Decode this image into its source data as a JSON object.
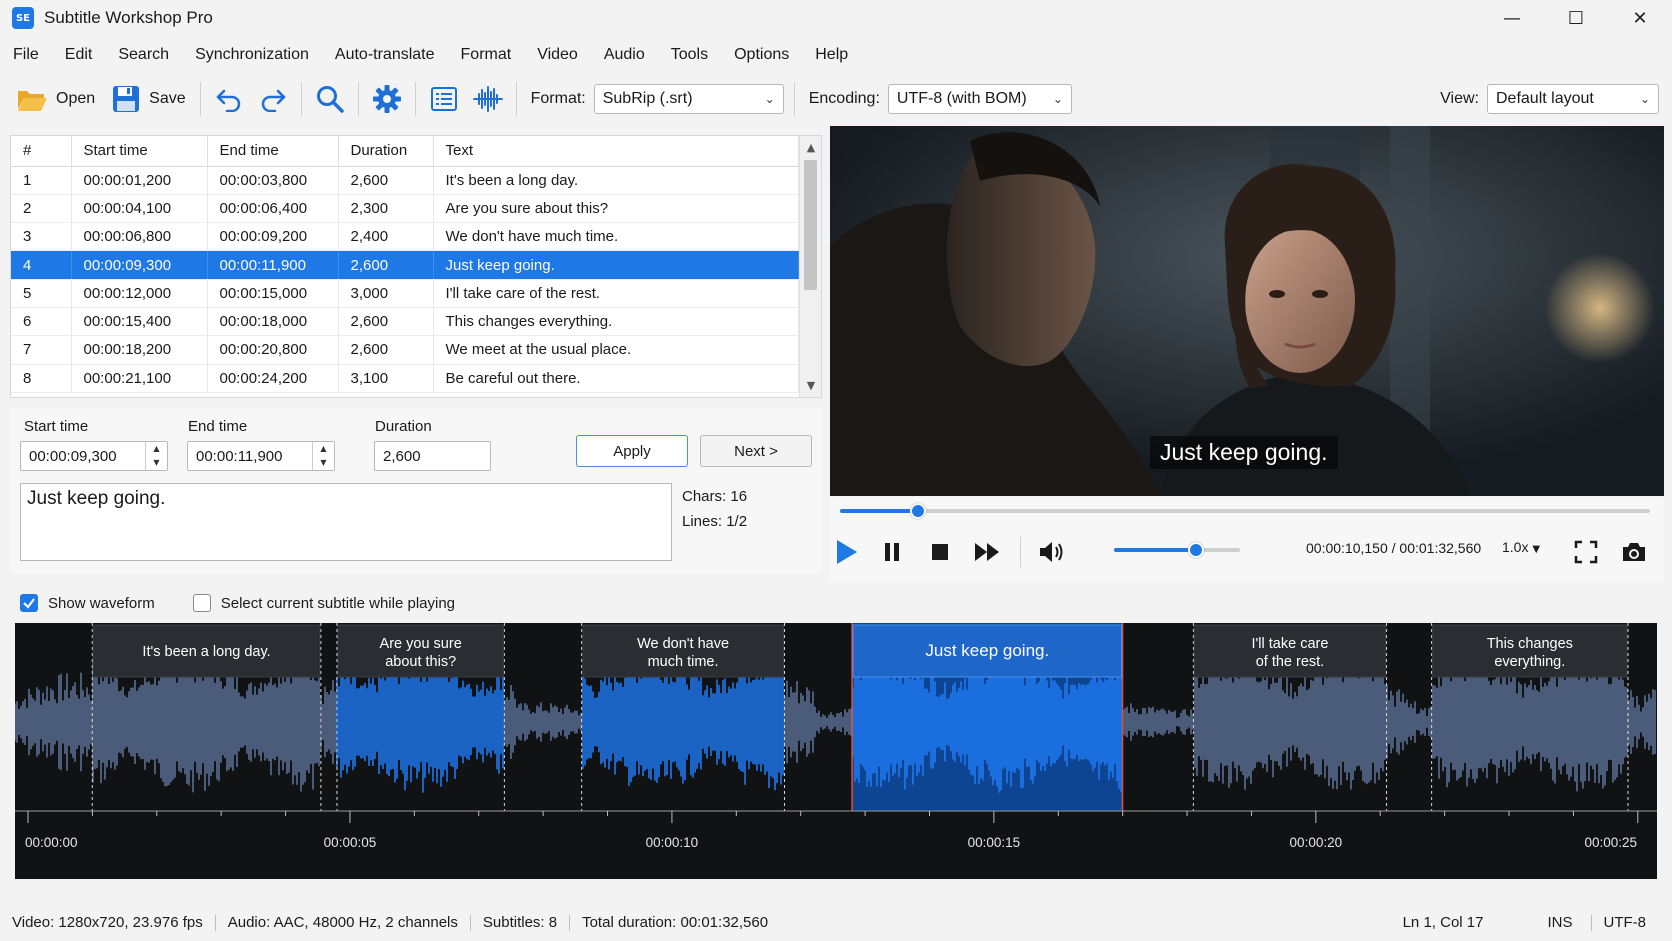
{
  "window": {
    "logo": "SE",
    "title": "Subtitle Workshop Pro",
    "minimize": "—",
    "maximize": "☐",
    "close": "✕"
  },
  "menu": [
    "File",
    "Edit",
    "Search",
    "Synchronization",
    "Auto-translate",
    "Format",
    "Video",
    "Audio",
    "Tools",
    "Options",
    "Help"
  ],
  "toolbar": {
    "open_label": "Open",
    "save_label": "Save",
    "format_label": "Format:",
    "format_value": "SubRip (.srt)",
    "encoding_label": "Encoding:",
    "encoding_value": "UTF-8 (with BOM)",
    "view_label": "View:",
    "view_value": "Default layout"
  },
  "grid": {
    "columns": [
      "#",
      "Start time",
      "End time",
      "Duration",
      "Text"
    ],
    "selected_index": 3,
    "rows": [
      [
        "1",
        "00:00:01,200",
        "00:00:03,800",
        "2,600",
        "It's been a long day."
      ],
      [
        "2",
        "00:00:04,100",
        "00:00:06,400",
        "2,300",
        "Are you sure about this?"
      ],
      [
        "3",
        "00:00:06,800",
        "00:00:09,200",
        "2,400",
        "We don't have much time."
      ],
      [
        "4",
        "00:00:09,300",
        "00:00:11,900",
        "2,600",
        "Just keep going."
      ],
      [
        "5",
        "00:00:12,000",
        "00:00:15,000",
        "3,000",
        "I'll take care of the rest."
      ],
      [
        "6",
        "00:00:15,400",
        "00:00:18,000",
        "2,600",
        "This changes everything."
      ],
      [
        "7",
        "00:00:18,200",
        "00:00:20,800",
        "2,600",
        "We meet at the usual place."
      ],
      [
        "8",
        "00:00:21,100",
        "00:00:24,200",
        "3,100",
        "Be careful out there."
      ]
    ]
  },
  "editor": {
    "start_label": "Start time",
    "start_value": "00:00:09,300",
    "end_label": "End time",
    "end_value": "00:00:11,900",
    "duration_label": "Duration",
    "duration_value": "2,600",
    "apply_label": "Apply",
    "next_label": "Next >",
    "text_value": "Just keep going.",
    "chars": "Chars: 16",
    "lines": "Lines: 1/2"
  },
  "video": {
    "subtitle": "Just keep going."
  },
  "player": {
    "progress_fraction": 0.0958,
    "volume_fraction": 0.65,
    "time_readout": "00:00:10,150 / 00:01:32,560",
    "speed": "1.0x"
  },
  "waveform_options": {
    "show_waveform_label": "Show waveform",
    "show_waveform_checked": true,
    "select_current_label": "Select current subtitle while playing",
    "select_current_checked": false
  },
  "waveform": {
    "visible_range_seconds": [
      0,
      25.5
    ],
    "selected_index": 3,
    "segments": [
      {
        "start": 1.2,
        "end": 4.75,
        "lines": [
          "It's been a long day."
        ]
      },
      {
        "start": 5.0,
        "end": 7.6,
        "lines": [
          "Are you sure",
          "about this?"
        ]
      },
      {
        "start": 8.8,
        "end": 11.95,
        "lines": [
          "We don't have",
          "much time."
        ]
      },
      {
        "start": 13.0,
        "end": 17.2,
        "lines": [
          "Just keep going."
        ]
      },
      {
        "start": 18.3,
        "end": 21.3,
        "lines": [
          "I'll take care",
          "of the rest."
        ]
      },
      {
        "start": 22.0,
        "end": 25.05,
        "lines": [
          "This changes",
          "everything."
        ]
      }
    ],
    "tick_labels": [
      {
        "t": 0,
        "label": "00:00:00"
      },
      {
        "t": 5,
        "label": "00:00:05"
      },
      {
        "t": 10,
        "label": "00:00:10"
      },
      {
        "t": 15,
        "label": "00:00:15"
      },
      {
        "t": 20,
        "label": "00:00:20"
      },
      {
        "t": 25,
        "label": "00:00:25"
      }
    ],
    "colors": {
      "background": "#111214",
      "wave": "#5a6f94",
      "wave_active": "#1e78f0",
      "selection": "#0e4fa8",
      "marker": "#e0533a"
    }
  },
  "status": {
    "video": "Video: 1280x720, 23.976 fps",
    "audio": "Audio: AAC, 48000 Hz, 2 channels",
    "subtitles": "Subtitles: 8",
    "total": "Total duration: 00:01:32,560",
    "position": "Ln 1, Col 17",
    "mode": "INS",
    "encoding": "UTF-8"
  }
}
